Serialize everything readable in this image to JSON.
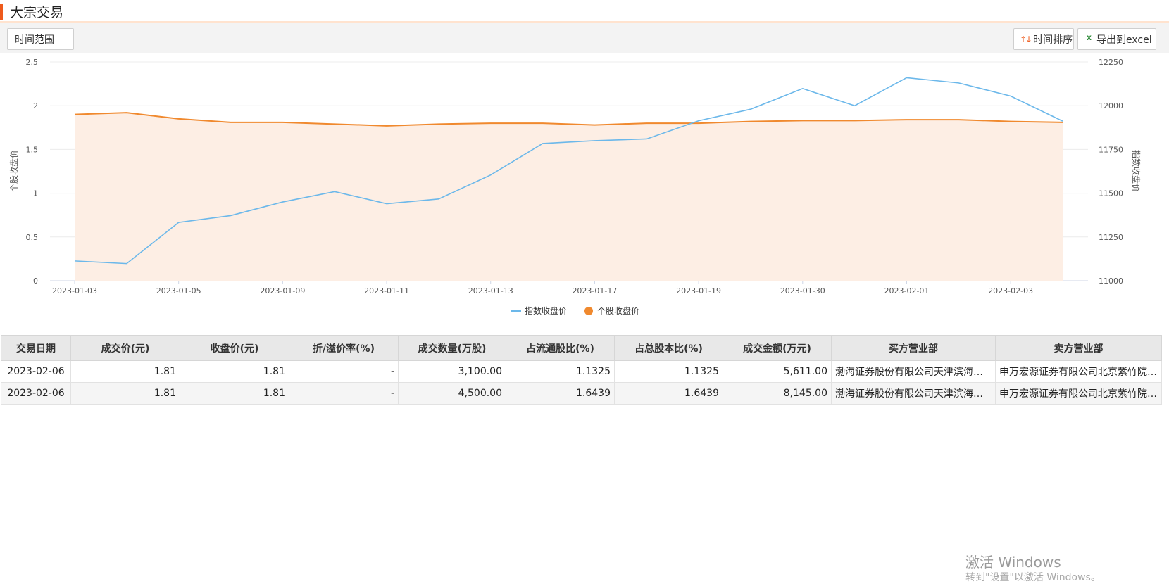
{
  "section": {
    "title": "大宗交易"
  },
  "toolbar": {
    "range_label": "时间范围",
    "sort_label": "时间排序",
    "export_label": "导出到excel"
  },
  "chart_data": {
    "type": "line",
    "x_tick_labels": [
      "2023-01-03",
      "2023-01-05",
      "2023-01-09",
      "2023-01-11",
      "2023-01-13",
      "2023-01-17",
      "2023-01-19",
      "2023-01-30",
      "2023-02-01",
      "2023-02-03"
    ],
    "y_left": {
      "label": "个股收盘价",
      "ticks": [
        "0",
        "0.5",
        "1",
        "1.5",
        "2",
        "2.5"
      ],
      "min": 0,
      "max": 2.5
    },
    "y_right": {
      "label": "指数收盘价",
      "ticks": [
        "11000",
        "11250",
        "11500",
        "11750",
        "12000",
        "12250"
      ],
      "min": 11000,
      "max": 12250
    },
    "series": [
      {
        "name": "指数收盘价",
        "axis": "right",
        "color": "#6cb8ea",
        "values": [
          11113,
          11098,
          11333,
          11372,
          11450,
          11509,
          11440,
          11467,
          11604,
          11784,
          11800,
          11810,
          11914,
          11980,
          12098,
          12000,
          12160,
          12130,
          12055,
          11912
        ]
      },
      {
        "name": "个股收盘价",
        "axis": "left",
        "color": "#f0892e",
        "area_fill": "#fdeee4",
        "values": [
          1.9,
          1.92,
          1.85,
          1.81,
          1.81,
          1.79,
          1.77,
          1.79,
          1.8,
          1.8,
          1.78,
          1.8,
          1.8,
          1.82,
          1.83,
          1.83,
          1.84,
          1.84,
          1.82,
          1.81
        ]
      }
    ],
    "legend": {
      "placement": "bottom-center"
    },
    "grid": true
  },
  "table": {
    "headers": [
      "交易日期",
      "成交价(元)",
      "收盘价(元)",
      "折/溢价率(%)",
      "成交数量(万股)",
      "占流通股比(%)",
      "占总股本比(%)",
      "成交金额(万元)",
      "买方营业部",
      "卖方营业部"
    ],
    "rows": [
      [
        "2023-02-06",
        "1.81",
        "1.81",
        "-",
        "3,100.00",
        "1.1325",
        "1.1325",
        "5,611.00",
        "渤海证券股份有限公司天津滨海新区...",
        "申万宏源证券有限公司北京紫竹院路..."
      ],
      [
        "2023-02-06",
        "1.81",
        "1.81",
        "-",
        "4,500.00",
        "1.6439",
        "1.6439",
        "8,145.00",
        "渤海证券股份有限公司天津滨海新区...",
        "申万宏源证券有限公司北京紫竹院路..."
      ]
    ]
  },
  "watermark": {
    "line1": "激活 Windows",
    "line2": "转到\"设置\"以激活 Windows。"
  }
}
